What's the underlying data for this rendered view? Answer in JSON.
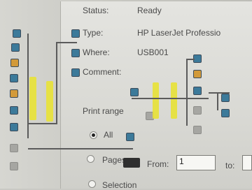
{
  "print_dialog": {
    "status_label": "Status:",
    "status_value": "Ready",
    "type_label": "Type:",
    "type_value": "HP LaserJet Professio",
    "where_label": "Where:",
    "where_value": "USB001",
    "comment_label": "Comment:",
    "print_range_label": "Print range",
    "range_all_label": "All",
    "range_pages_label": "Pages",
    "range_selection_label": "Selection",
    "from_label": "From:",
    "from_value": "1",
    "to_label": "to:"
  }
}
